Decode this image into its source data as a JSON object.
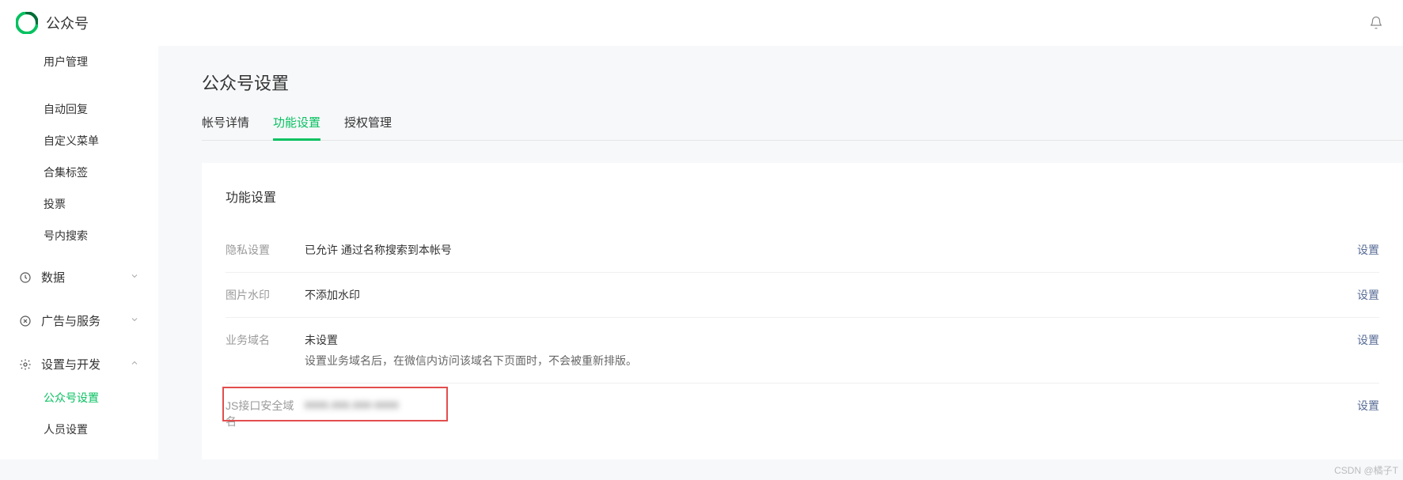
{
  "header": {
    "brand": "公众号"
  },
  "sidebar": {
    "items": [
      {
        "label": "用户管理"
      },
      {
        "label": "自动回复"
      },
      {
        "label": "自定义菜单"
      },
      {
        "label": "合集标签"
      },
      {
        "label": "投票"
      },
      {
        "label": "号内搜索"
      }
    ],
    "groups": [
      {
        "label": "数据",
        "expanded": false
      },
      {
        "label": "广告与服务",
        "expanded": false
      },
      {
        "label": "设置与开发",
        "expanded": true
      }
    ],
    "sub_settings": [
      {
        "label": "公众号设置",
        "active": true
      },
      {
        "label": "人员设置",
        "active": false
      }
    ]
  },
  "page": {
    "title": "公众号设置",
    "tabs": [
      {
        "label": "帐号详情",
        "active": false
      },
      {
        "label": "功能设置",
        "active": true
      },
      {
        "label": "授权管理",
        "active": false
      }
    ]
  },
  "card": {
    "title": "功能设置",
    "rows": [
      {
        "label": "隐私设置",
        "value": "已允许 通过名称搜索到本帐号",
        "action": "设置"
      },
      {
        "label": "图片水印",
        "value": "不添加水印",
        "action": "设置"
      },
      {
        "label": "业务域名",
        "value": "未设置",
        "sub": "设置业务域名后，在微信内访问该域名下页面时，不会被重新排版。",
        "action": "设置"
      },
      {
        "label": "JS接口安全域名",
        "value": "xxxx.xxx.xxx-xxxx",
        "action": "设置",
        "highlight": true
      }
    ]
  },
  "watermark": "CSDN @橘子T"
}
